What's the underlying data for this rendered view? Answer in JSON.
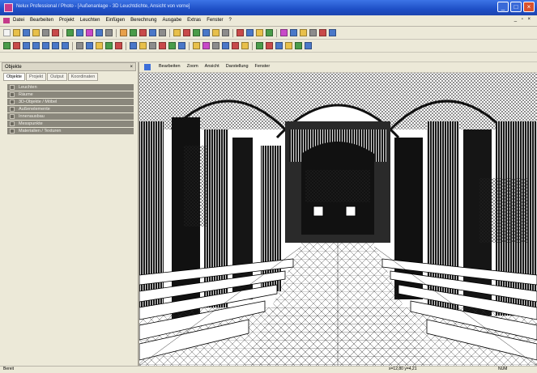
{
  "window": {
    "title": "Nelux Professional / Photo - [Außenanlage - 3D Leuchtdichte, Ansicht von vorne]",
    "buttons": [
      "minimize",
      "maximize",
      "close"
    ]
  },
  "menu": {
    "items": [
      "Datei",
      "Bearbeiten",
      "Projekt",
      "Leuchten",
      "Einfügen",
      "Berechnung",
      "Ausgabe",
      "Extras",
      "Fenster",
      "?"
    ]
  },
  "panel": {
    "title": "Objekte",
    "tabs": [
      "Objekte",
      "Projekt",
      "Output",
      "Koordinaten"
    ],
    "active_tab": 0,
    "layers": [
      "Leuchten",
      "Räume",
      "3D-Objekte / Möbel",
      "Außenelemente",
      "Innenausbau",
      "Messpunkte",
      "Materialien / Texturen"
    ]
  },
  "view_menu": {
    "items": [
      "Bearbeiten",
      "Zoom",
      "Ansicht",
      "Darstellung",
      "Fenster"
    ]
  },
  "status": {
    "left": "Bereit",
    "right_coords": "x=12,80 y=4,21",
    "right_mode": "NUM"
  },
  "colors": {
    "titlebar": "#1e4fc6",
    "panel_bg": "#ece9d8",
    "layer_bg": "#8a877c",
    "render_bg": "#ffffff",
    "render_dark": "#111111"
  }
}
